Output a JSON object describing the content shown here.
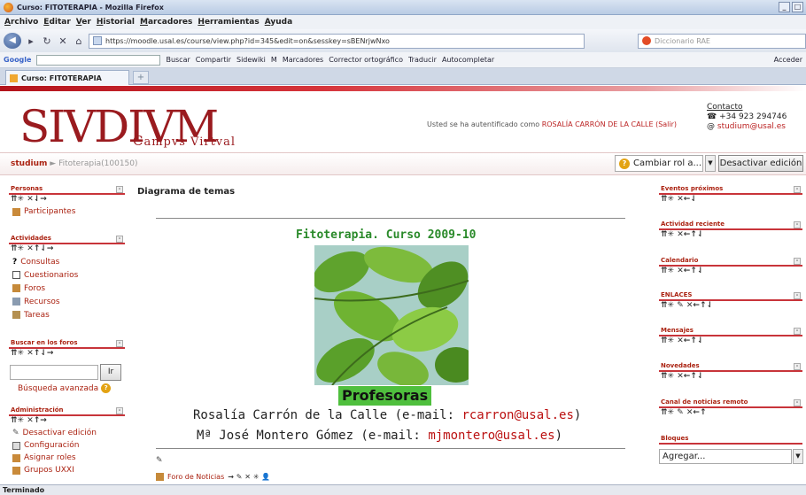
{
  "window": {
    "title": "Curso: FITOTERAPIA - Mozilla Firefox"
  },
  "menu": [
    "Archivo",
    "Editar",
    "Ver",
    "Historial",
    "Marcadores",
    "Herramientas",
    "Ayuda"
  ],
  "nav": {
    "url": "https://moodle.usal.es/course/view.php?id=345&edit=on&sesskey=sBENrjwNxo",
    "search_placeholder": "Diccionario RAE"
  },
  "googlebar": {
    "logo": "Google",
    "items": [
      "Buscar",
      "Compartir",
      "Sidewiki",
      "M",
      "Marcadores",
      "Corrector ortográfico",
      "Traducir",
      "Autocompletar",
      "Acceder"
    ]
  },
  "tab": {
    "label": "Curso: FITOTERAPIA",
    "new": "+"
  },
  "header": {
    "logo": "SIVDIVM",
    "logo_sub": "Campvs Virtval",
    "login_prefix": "Usted se ha autentificado como",
    "login_user": "ROSALÍA CARRÓN DE LA CALLE",
    "logout": "(Salir)",
    "contact_title": "Contacto",
    "phone": "+34 923 294746",
    "email": "studium@usal.es"
  },
  "breadcrumb": {
    "home": "studium",
    "sep": "►",
    "current": "Fitoterapia(100150)"
  },
  "toolbar": {
    "role_select": "Cambiar rol a...",
    "edit_button": "Desactivar edición"
  },
  "left": {
    "personas": {
      "title": "Personas",
      "controls": "⇈✳ ✕⇃→",
      "items": [
        "Participantes"
      ]
    },
    "actividades": {
      "title": "Actividades",
      "controls": "⇈✳ ✕↑⇃→",
      "items": [
        "Consultas",
        "Cuestionarios",
        "Foros",
        "Recursos",
        "Tareas"
      ]
    },
    "buscar": {
      "title": "Buscar en los foros",
      "controls": "⇈✳ ✕↑⇃→",
      "go": "Ir",
      "advanced": "Búsqueda avanzada"
    },
    "admin": {
      "title": "Administración",
      "controls": "⇈✳ ✕↑→",
      "items": [
        "Desactivar edición",
        "Configuración",
        "Asignar roles",
        "Grupos UXXI"
      ]
    }
  },
  "center": {
    "section_title": "Diagrama de temas",
    "course_title": "Fitoterapia. Curso 2009-10",
    "profesoras": "Profesoras",
    "prof1_name": "Rosalía Carrón de la Calle (e-mail:",
    "prof1_mail": "rcarron@usal.es",
    "prof2_name": "Mª José Montero Gómez (e-mail:",
    "prof2_mail": "mjmontero@usal.es",
    "close_paren": ")",
    "forum_link": "Foro de Noticias",
    "forum_controls": "→ ✎ ✕ ✳ 👤"
  },
  "right": {
    "blocks": [
      {
        "title": "Eventos próximos",
        "controls": "⇈✳ ✕←⇃"
      },
      {
        "title": "Actividad reciente",
        "controls": "⇈✳ ✕←↑⇃"
      },
      {
        "title": "Calendario",
        "controls": "⇈✳ ✕←↑⇃"
      },
      {
        "title": "ENLACES",
        "controls": "⇈✳ ✎ ✕←↑⇃"
      },
      {
        "title": "Mensajes",
        "controls": "⇈✳ ✕←↑⇃"
      },
      {
        "title": "Novedades",
        "controls": "⇈✳ ✕←↑⇃"
      },
      {
        "title": "Canal de noticias remoto",
        "controls": "⇈✳ ✎ ✕←↑"
      },
      {
        "title": "Bloques",
        "controls": ""
      }
    ],
    "add_select": "Agregar..."
  },
  "status": "Terminado"
}
